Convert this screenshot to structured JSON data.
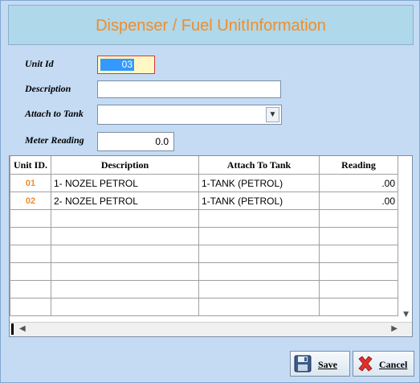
{
  "title": "Dispenser / Fuel UnitInformation",
  "form": {
    "unit_id_label": "Unit Id",
    "unit_id_value": "03",
    "description_label": "Description",
    "description_value": "",
    "tank_label": "Attach to Tank",
    "tank_value": "",
    "meter_label": "Meter Reading",
    "meter_value": "0.0"
  },
  "grid": {
    "columns": [
      "Unit ID.",
      "Description",
      "Attach To Tank",
      "Reading"
    ],
    "rows": [
      [
        "01",
        "1- NOZEL PETROL",
        "1-TANK (PETROL)",
        ".00"
      ],
      [
        "02",
        "2- NOZEL PETROL",
        "1-TANK (PETROL)",
        ".00"
      ]
    ],
    "empty_rows": 6
  },
  "buttons": {
    "save": "Save",
    "cancel": "Cancel"
  },
  "colors": {
    "title": "#f28c28",
    "window_bg": "#c5dbf4",
    "title_bg": "#afd8ea"
  }
}
